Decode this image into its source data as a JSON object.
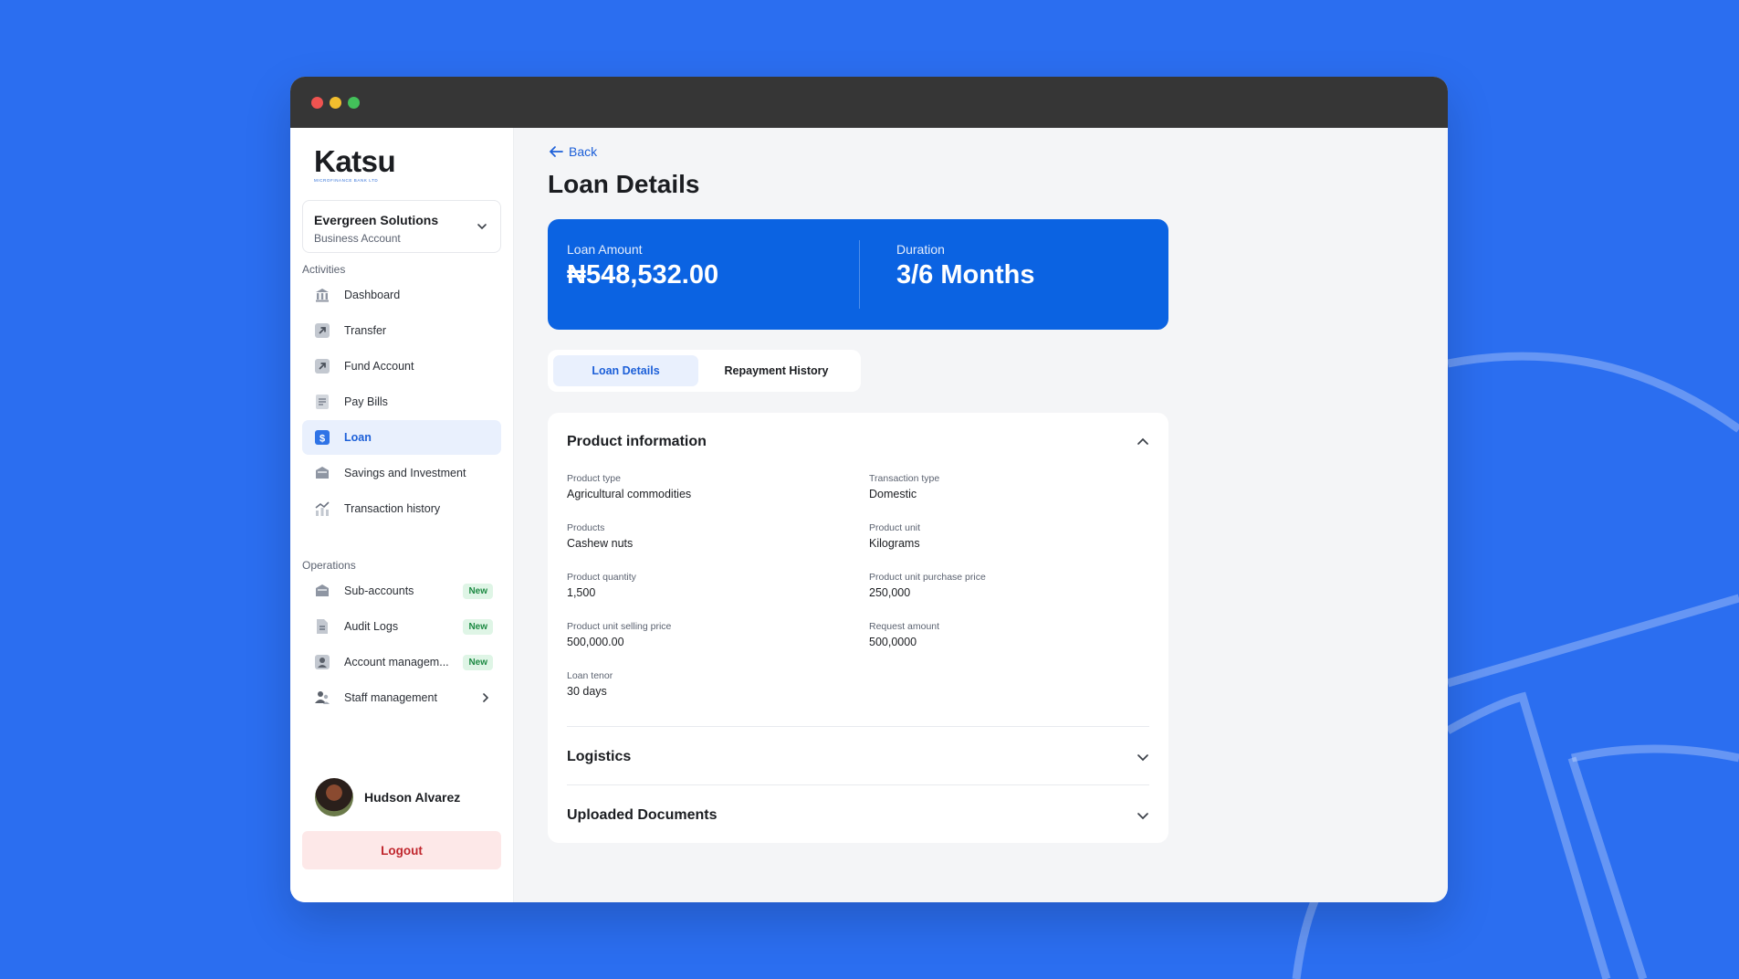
{
  "colors": {
    "background": "#2B6EF0",
    "accent": "#0B63E2",
    "active_nav_bg": "#E9F0FD",
    "new_badge_bg": "#DFF5E6",
    "logout_bg": "#FDE8E8",
    "logout_text": "#C0262D"
  },
  "brand": {
    "name": "Katsu",
    "tagline": "MICROFINANCE BANK LTD"
  },
  "account": {
    "name": "Evergreen Solutions",
    "type": "Business Account"
  },
  "sidebar": {
    "activities_title": "Activities",
    "activities": [
      {
        "label": "Dashboard",
        "icon": "bank-icon"
      },
      {
        "label": "Transfer",
        "icon": "arrow-up-right-icon"
      },
      {
        "label": "Fund Account",
        "icon": "arrow-up-right-icon"
      },
      {
        "label": "Pay Bills",
        "icon": "bill-icon"
      },
      {
        "label": "Loan",
        "icon": "dollar-icon",
        "active": true
      },
      {
        "label": "Savings and Investment",
        "icon": "safe-icon"
      },
      {
        "label": "Transaction history",
        "icon": "chart-icon"
      }
    ],
    "operations_title": "Operations",
    "operations": [
      {
        "label": "Sub-accounts",
        "icon": "folder-icon",
        "badge": "New"
      },
      {
        "label": "Audit Logs",
        "icon": "document-icon",
        "badge": "New"
      },
      {
        "label": "Account managem...",
        "icon": "user-card-icon",
        "badge": "New"
      },
      {
        "label": "Staff management",
        "icon": "users-icon"
      }
    ]
  },
  "user": {
    "name": "Hudson Alvarez"
  },
  "logout_label": "Logout",
  "main": {
    "back_label": "Back",
    "title": "Loan Details",
    "loan_amount_label": "Loan Amount",
    "loan_amount_value": "₦548,532.00",
    "duration_label": "Duration",
    "duration_value": "3/6 Months",
    "tabs": [
      "Loan Details",
      "Repayment History"
    ],
    "product_info": {
      "title": "Product information",
      "fields": [
        {
          "label": "Product type",
          "value": "Agricultural commodities"
        },
        {
          "label": "Transaction type",
          "value": "Domestic"
        },
        {
          "label": "Products",
          "value": "Cashew nuts"
        },
        {
          "label": "Product unit",
          "value": "Kilograms"
        },
        {
          "label": "Product quantity",
          "value": "1,500"
        },
        {
          "label": "Product unit purchase price",
          "value": "250,000"
        },
        {
          "label": "Product unit selling price",
          "value": "500,000.00"
        },
        {
          "label": "Request amount",
          "value": "500,0000"
        },
        {
          "label": "Loan tenor",
          "value": "30 days"
        }
      ]
    },
    "logistics_title": "Logistics",
    "documents_title": "Uploaded Documents"
  }
}
